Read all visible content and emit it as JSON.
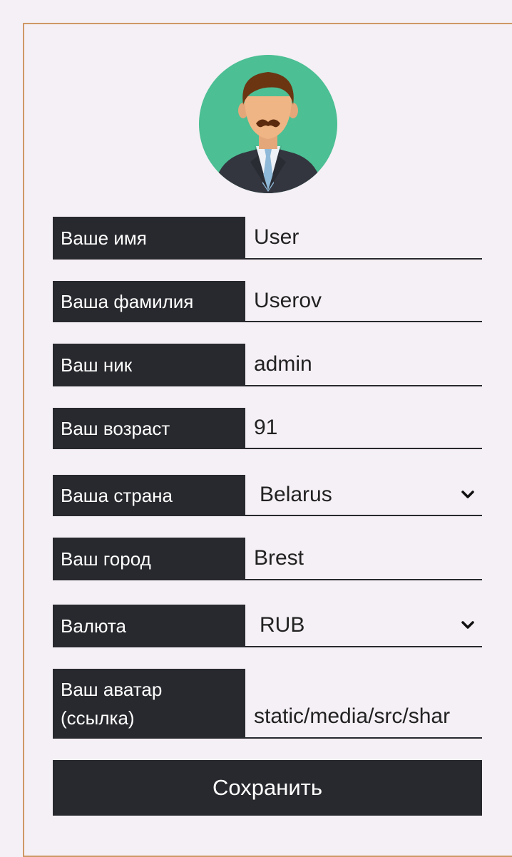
{
  "profile": {
    "avatar_icon": "user-avatar-icon",
    "fields": [
      {
        "label": "Ваше имя",
        "value": "User"
      },
      {
        "label": "Ваша фамилия",
        "value": "Userov"
      },
      {
        "label": "Ваш ник",
        "value": "admin"
      },
      {
        "label": "Ваш возраст",
        "value": "91"
      },
      {
        "label": "Ваша страна",
        "value": "Belarus"
      },
      {
        "label": "Ваш город",
        "value": "Brest"
      },
      {
        "label": "Валюта",
        "value": "RUB"
      },
      {
        "label_line1": "Ваш аватар",
        "label_line2": "(ссылка)",
        "value": "static/media/src/shar"
      }
    ],
    "save_label": "Сохранить"
  },
  "colors": {
    "label_bg": "#28292e",
    "border_accent": "#cf9866",
    "avatar_bg": "#4cbf94",
    "page_bg": "#f5f0f5"
  }
}
